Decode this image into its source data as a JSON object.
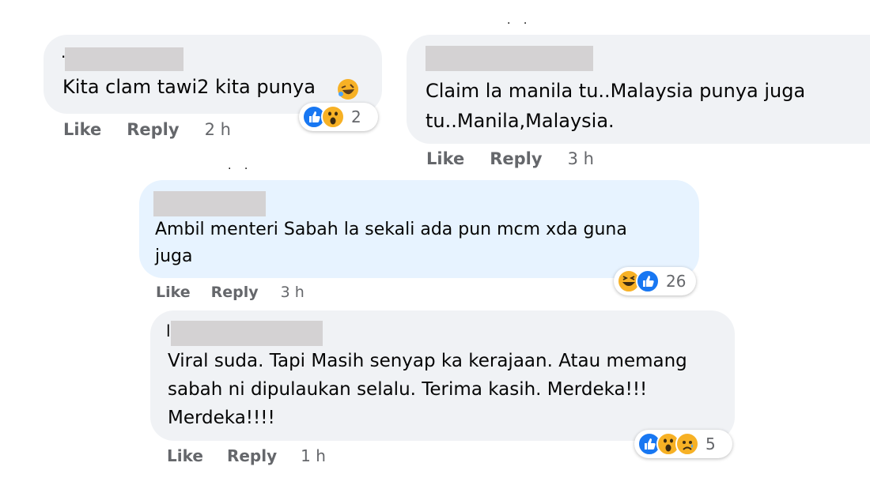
{
  "comments": [
    {
      "text": "Kita clam tawi2 kita punya",
      "name_prefix": ".",
      "actions": {
        "like": "Like",
        "reply": "Reply",
        "time": "2 h"
      },
      "reactions": {
        "icons": [
          "like-icon",
          "wow-icon"
        ],
        "count": "2"
      }
    },
    {
      "text": "Claim la manila tu..Malaysia punya juga\ntu..Manila,Malaysia.",
      "actions": {
        "like": "Like",
        "reply": "Reply",
        "time": "3 h"
      }
    },
    {
      "text": "Ambil menteri Sabah la sekali ada pun mcm xda guna\njuga",
      "actions": {
        "like": "Like",
        "reply": "Reply",
        "time": "3 h"
      },
      "reactions": {
        "icons": [
          "haha-icon",
          "like-icon"
        ],
        "count": "26"
      }
    },
    {
      "text": "Viral suda. Tapi Masih senyap ka kerajaan. Atau memang\nsabah ni dipulaukan selalu. Terima kasih. Merdeka!!!\nMerdeka!!!!",
      "name_prefix": "l",
      "actions": {
        "like": "Like",
        "reply": "Reply",
        "time": "1 h"
      },
      "reactions": {
        "icons": [
          "like-icon",
          "wow-icon",
          "sad-icon"
        ],
        "count": "5"
      }
    }
  ],
  "colors": {
    "bubble_grey": "#f0f2f5",
    "bubble_blue": "#e7f3ff",
    "like_blue": "#1877f2",
    "emoji_yellow": "#f7b125",
    "meta_grey": "#65676b"
  }
}
